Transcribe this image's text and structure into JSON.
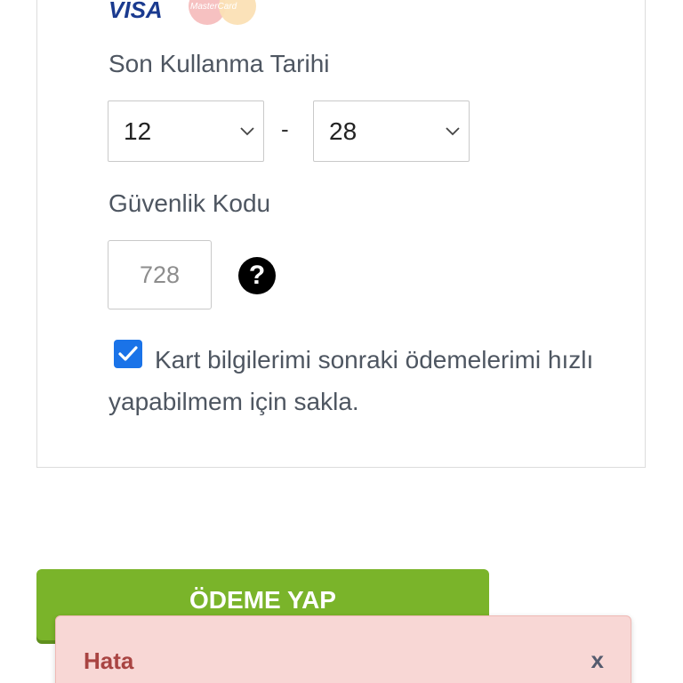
{
  "card_logos": {
    "visa": "VISA",
    "mastercard": "MasterCard"
  },
  "expiry": {
    "label": "Son Kullanma Tarihi",
    "month": "12",
    "separator": "-",
    "year": "28"
  },
  "security": {
    "label": "Güvenlik Kodu",
    "placeholder": "728",
    "help_symbol": "?"
  },
  "save_card": {
    "checked": true,
    "text": "Kart bilgilerimi sonraki ödemelerimi hızlı yapabilmem için sakla."
  },
  "pay_button": {
    "label": "ÖDEME YAP"
  },
  "alert": {
    "title": "Hata",
    "close": "x"
  },
  "colors": {
    "pay_button": "#7ab42a",
    "checkbox": "#1a73e8",
    "alert_bg": "#f8d7d5",
    "alert_title": "#a94442"
  }
}
